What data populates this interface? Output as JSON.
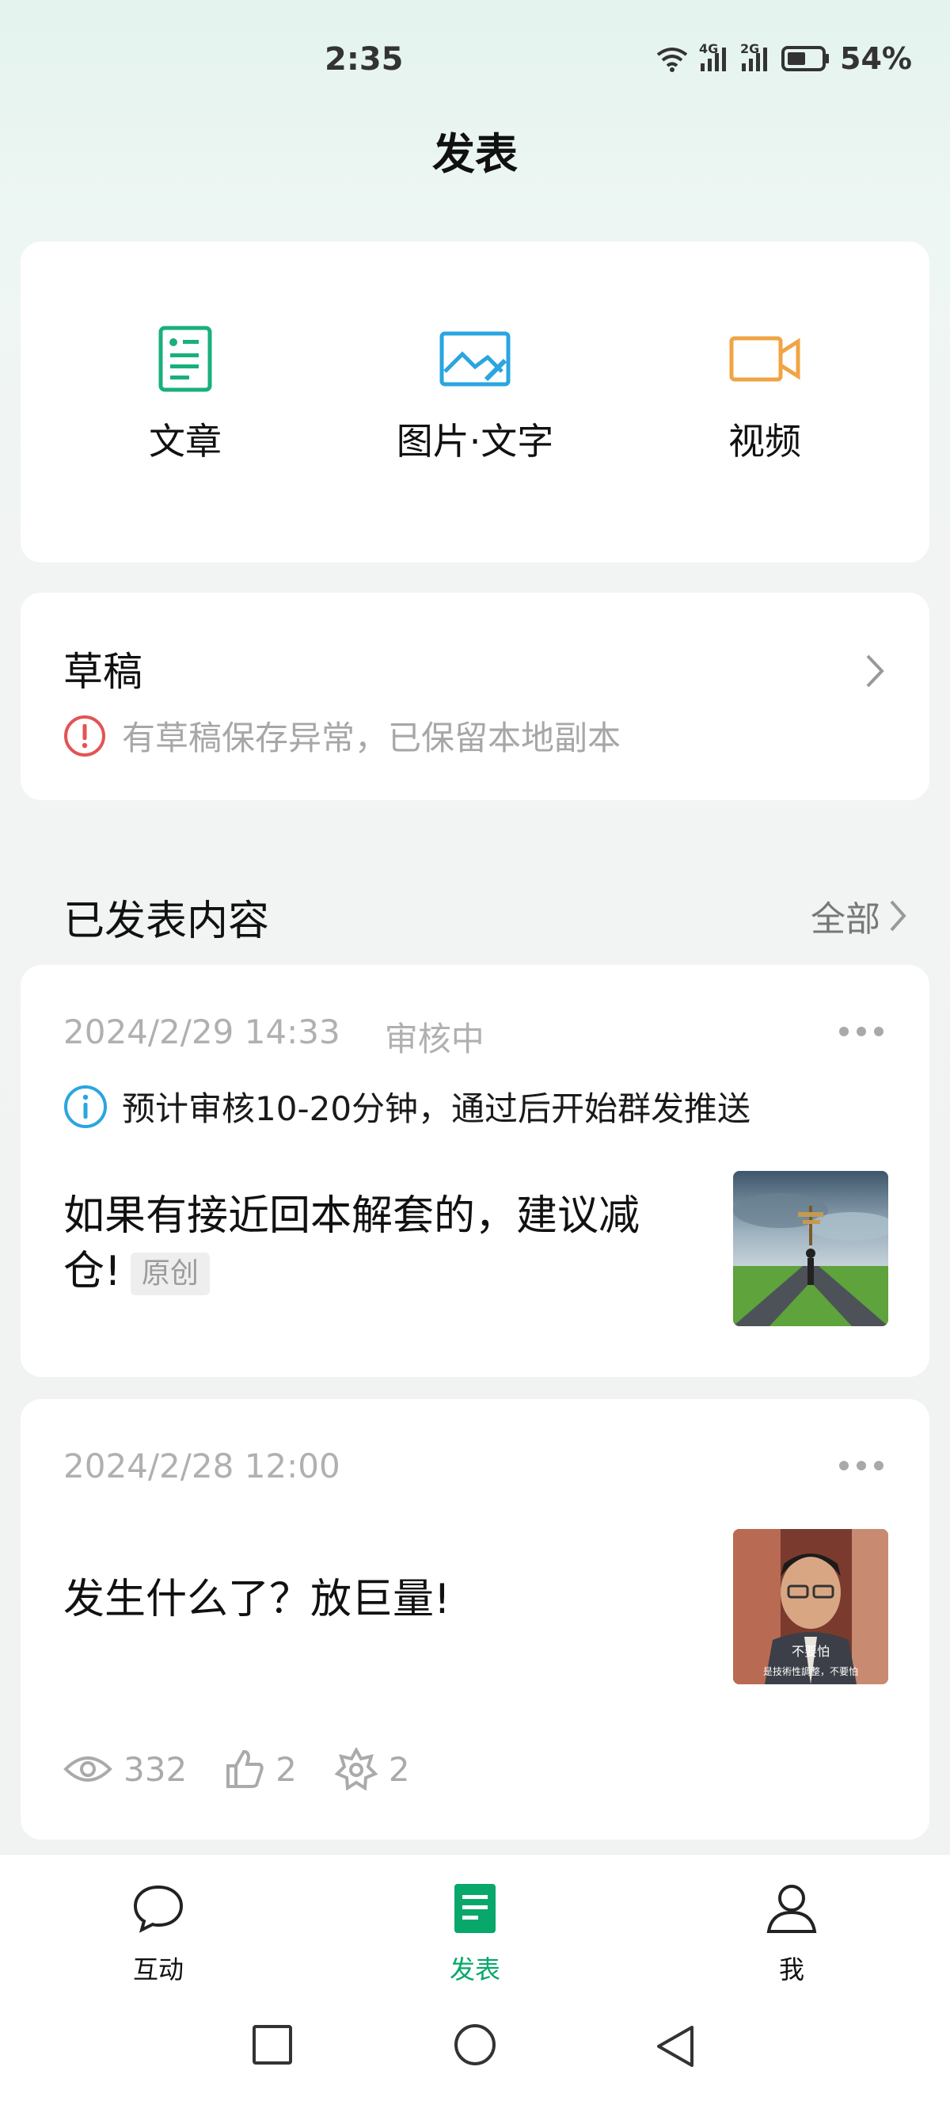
{
  "status_bar": {
    "time": "2:35",
    "network_1": "4G",
    "network_2": "2G",
    "battery": "54%"
  },
  "header": {
    "title": "发表"
  },
  "publish": {
    "items": [
      {
        "label": "文章",
        "icon": "article-icon",
        "color": "#19b07b"
      },
      {
        "label": "图片·文字",
        "icon": "image-text-icon",
        "color": "#2aa5e0"
      },
      {
        "label": "视频",
        "icon": "video-icon",
        "color": "#f0a444"
      }
    ]
  },
  "drafts": {
    "title": "草稿",
    "warning": "有草稿保存异常，已保留本地副本",
    "warning_color": "#e45353"
  },
  "published": {
    "section_title": "已发表内容",
    "all_label": "全部",
    "posts": [
      {
        "date": "2024/2/29 14:33",
        "status": "审核中",
        "info": "预计审核10-20分钟，通过后开始群发推送",
        "title_line1": "如果有接近回本解套的，建议减",
        "title_line2": "仓!",
        "tag": "原创",
        "thumb": "crossroads-image"
      },
      {
        "date": "2024/2/28 12:00",
        "title": "发生什么了？放巨量!",
        "thumb": "meme-image",
        "thumb_caption_1": "不要怕",
        "thumb_caption_2": "是技術性調整，不要怕",
        "stats": {
          "views": "332",
          "likes": "2",
          "shares": "2"
        }
      }
    ]
  },
  "bottom_nav": {
    "items": [
      {
        "label": "互动",
        "icon": "chat-bubble-icon"
      },
      {
        "label": "发表",
        "icon": "publish-doc-icon",
        "active": true
      },
      {
        "label": "我",
        "icon": "person-icon"
      }
    ],
    "active_color": "#07a86a"
  }
}
